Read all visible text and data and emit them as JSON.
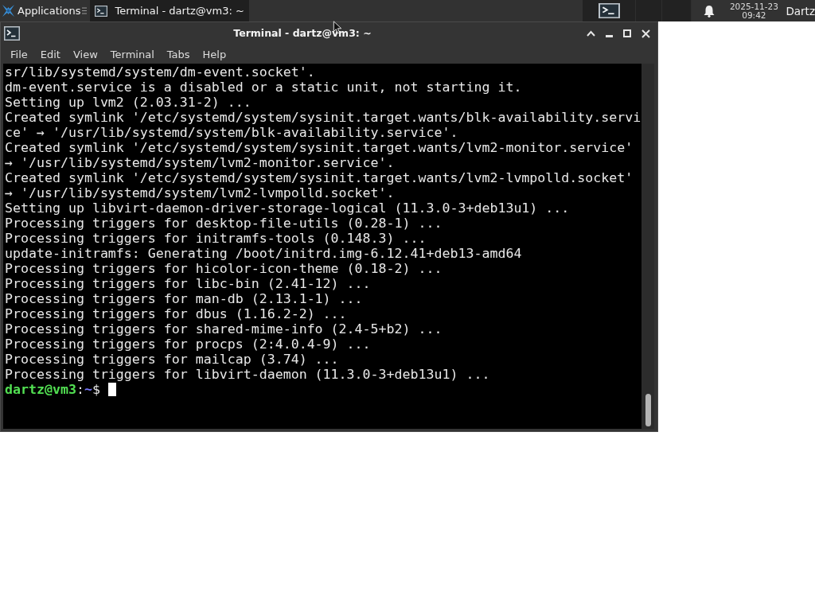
{
  "panel": {
    "applications_menu": "Applications",
    "tasks": [
      {
        "title": "Terminal - dartz@vm3: ~",
        "selected": true
      }
    ],
    "clock": {
      "date": "2025-11-23",
      "time": "09:42"
    },
    "user": "Dartz"
  },
  "window": {
    "title": "Terminal - dartz@vm3: ~",
    "menu": [
      "File",
      "Edit",
      "View",
      "Terminal",
      "Tabs",
      "Help"
    ],
    "terminal": {
      "lines": [
        "sr/lib/systemd/system/dm-event.socket'.",
        "dm-event.service is a disabled or a static unit, not starting it.",
        "Setting up lvm2 (2.03.31-2) ...",
        "Created symlink '/etc/systemd/system/sysinit.target.wants/blk-availability.servi",
        "ce' → '/usr/lib/systemd/system/blk-availability.service'.",
        "Created symlink '/etc/systemd/system/sysinit.target.wants/lvm2-monitor.service'",
        "→ '/usr/lib/systemd/system/lvm2-monitor.service'.",
        "Created symlink '/etc/systemd/system/sysinit.target.wants/lvm2-lvmpolld.socket'",
        "→ '/usr/lib/systemd/system/lvm2-lvmpolld.socket'.",
        "Setting up libvirt-daemon-driver-storage-logical (11.3.0-3+deb13u1) ...",
        "Processing triggers for desktop-file-utils (0.28-1) ...",
        "Processing triggers for initramfs-tools (0.148.3) ...",
        "update-initramfs: Generating /boot/initrd.img-6.12.41+deb13-amd64",
        "Processing triggers for hicolor-icon-theme (0.18-2) ...",
        "Processing triggers for libc-bin (2.41-12) ...",
        "Processing triggers for man-db (2.13.1-1) ...",
        "Processing triggers for dbus (1.16.2-2) ...",
        "Processing triggers for shared-mime-info (2.4-5+b2) ...",
        "Processing triggers for procps (2:4.0.4-9) ...",
        "Processing triggers for mailcap (3.74) ...",
        "Processing triggers for libvirt-daemon (11.3.0-3+deb13u1) ..."
      ],
      "prompt": {
        "user_host": "dartz@vm3",
        "separator": ":",
        "path": "~",
        "symbol": "$"
      }
    }
  }
}
